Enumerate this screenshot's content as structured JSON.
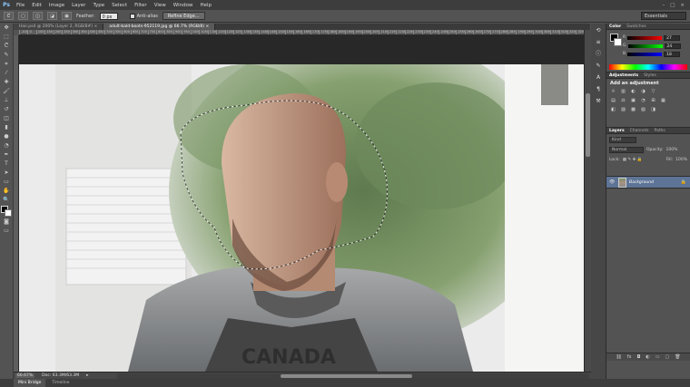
{
  "app": {
    "logo": "Ps"
  },
  "menu": [
    "File",
    "Edit",
    "Image",
    "Layer",
    "Type",
    "Select",
    "Filter",
    "View",
    "Window",
    "Help"
  ],
  "window_controls": [
    "–",
    "□",
    "×"
  ],
  "options": {
    "feather_label": "Feather:",
    "feather_value": "0 px",
    "anti_alias_label": "Anti-alias",
    "refine_edge_label": "Refine Edge...",
    "workspace": "Essentials"
  },
  "tabs": [
    {
      "label": "Hair.psd @ 200% (Layer 2, RGB/8#) ×",
      "active": false
    },
    {
      "label": "adult-bald-boots-952119.jpg @ 66.7% (RGB/8) ×",
      "active": true
    }
  ],
  "ruler_ticks": [
    "-100",
    "0",
    "100",
    "150",
    "200",
    "250",
    "300",
    "350",
    "400",
    "450",
    "500",
    "550",
    "600",
    "650",
    "700",
    "750",
    "800",
    "850",
    "900",
    "950",
    "1000",
    "1050",
    "1100",
    "1150",
    "1200",
    "1250",
    "1300",
    "1350",
    "1400",
    "1450",
    "1500",
    "1550",
    "1600",
    "1650",
    "1700",
    "1750",
    "1800",
    "1850",
    "1900",
    "1950",
    "2000",
    "2050",
    "2100",
    "2150",
    "2200",
    "2250",
    "2300",
    "2350",
    "2400",
    "2450",
    "2500",
    "2550",
    "2600",
    "2650",
    "2700",
    "2750",
    "2800",
    "2850",
    "2900",
    "2950",
    "3000",
    "3050",
    "3100",
    "3150",
    "3200",
    "3250",
    "3300"
  ],
  "status": {
    "zoom": "66.67%",
    "doc": "Doc: 63.3M/63.3M"
  },
  "bottom_tabs": [
    {
      "label": "Mini Bridge",
      "active": true
    },
    {
      "label": "Timeline",
      "active": false
    }
  ],
  "color_panel": {
    "tabs": [
      "Color",
      "Swatches"
    ],
    "sliders": [
      {
        "label": "R",
        "value": "27",
        "gradient": "linear-gradient(90deg,#000,#f00)"
      },
      {
        "label": "G",
        "value": "24",
        "gradient": "linear-gradient(90deg,#000,#0f0)"
      },
      {
        "label": "B",
        "value": "18",
        "gradient": "linear-gradient(90deg,#000,#00f)"
      }
    ]
  },
  "adjustments_panel": {
    "tabs": [
      "Adjustments",
      "Styles"
    ],
    "title": "Add an adjustment",
    "row1": [
      "☼",
      "▥",
      "◐",
      "◑",
      "▽"
    ],
    "row2": [
      "▤",
      "⚖",
      "▣",
      "◔",
      "⊞",
      "▦"
    ],
    "row3": [
      "◧",
      "▨",
      "▩",
      "▧",
      "◨"
    ]
  },
  "layers_panel": {
    "tabs": [
      "Layers",
      "Channels",
      "Paths"
    ],
    "kind": "Kind",
    "blend_mode": "Normal",
    "opacity_label": "Opacity:",
    "opacity_value": "100%",
    "lock_label": "Lock:",
    "fill_label": "Fill:",
    "fill_value": "100%",
    "layer_name": "Background",
    "footer_icons": [
      "⛓",
      "fx",
      "◘",
      "◐",
      "▭",
      "▢",
      "🗑"
    ]
  },
  "colors": {
    "accent": "#5e7496",
    "panel_bg": "#535353",
    "dark_bg": "#282828"
  }
}
